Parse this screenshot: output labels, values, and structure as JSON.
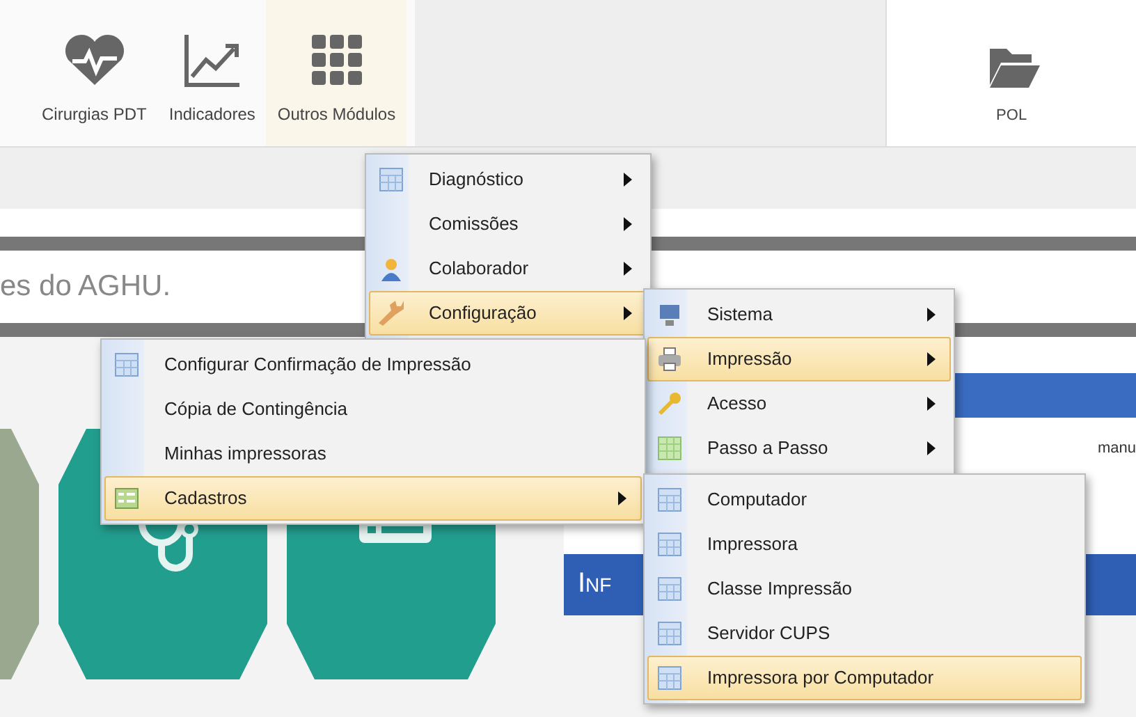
{
  "toolbar": {
    "items": [
      {
        "label": "Cirurgias PDT",
        "kind": "heart",
        "selected": false
      },
      {
        "label": "Indicadores",
        "kind": "chart",
        "selected": false
      },
      {
        "label": "Outros Módulos",
        "kind": "grid",
        "selected": true
      }
    ],
    "tab": {
      "label": "POL"
    }
  },
  "page": {
    "notice": "es do AGHU.",
    "side_text": "manu",
    "info_title": "Inf"
  },
  "menus": [
    {
      "items": [
        {
          "label": "Diagnóstico",
          "kind": "table",
          "submenu": true,
          "selected": false
        },
        {
          "label": "Comissões",
          "kind": "none",
          "submenu": true,
          "selected": false
        },
        {
          "label": "Colaborador",
          "kind": "person",
          "submenu": true,
          "selected": false
        },
        {
          "label": "Configuração",
          "kind": "wrench",
          "submenu": true,
          "selected": true
        }
      ]
    },
    {
      "items": [
        {
          "label": "Sistema",
          "kind": "monitor",
          "submenu": true,
          "selected": false
        },
        {
          "label": "Impressão",
          "kind": "printer",
          "submenu": true,
          "selected": true
        },
        {
          "label": "Acesso",
          "kind": "key",
          "submenu": true,
          "selected": false
        },
        {
          "label": "Passo a Passo",
          "kind": "sheet",
          "submenu": true,
          "selected": false
        }
      ]
    },
    {
      "items": [
        {
          "label": "Configurar Confirmação de Impressão",
          "kind": "table",
          "submenu": false,
          "selected": false
        },
        {
          "label": "Cópia de Contingência",
          "kind": "none",
          "submenu": false,
          "selected": false
        },
        {
          "label": "Minhas impressoras",
          "kind": "none",
          "submenu": false,
          "selected": false
        },
        {
          "label": "Cadastros",
          "kind": "form",
          "submenu": true,
          "selected": true
        }
      ]
    },
    {
      "items": [
        {
          "label": "Computador",
          "kind": "table",
          "submenu": false,
          "selected": false
        },
        {
          "label": "Impressora",
          "kind": "table",
          "submenu": false,
          "selected": false
        },
        {
          "label": "Classe Impressão",
          "kind": "table",
          "submenu": false,
          "selected": false
        },
        {
          "label": "Servidor CUPS",
          "kind": "table",
          "submenu": false,
          "selected": false
        },
        {
          "label": "Impressora por Computador",
          "kind": "table",
          "submenu": false,
          "selected": true
        }
      ]
    }
  ]
}
